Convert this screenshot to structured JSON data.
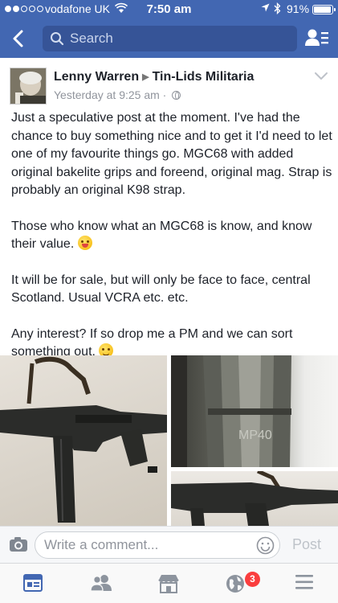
{
  "status_bar": {
    "carrier": "vodafone UK",
    "time": "7:50 am",
    "battery_percent": "91%"
  },
  "nav": {
    "search_placeholder": "Search"
  },
  "post": {
    "author": "Lenny Warren",
    "group": "Tin-Lids Militaria",
    "timestamp": "Yesterday at 9:25 am ·",
    "paragraphs": [
      "Just a speculative post at the moment. I've had the chance to buy something nice and to get it I'd need to let one of my favourite things go. MGC68 with added original bakelite grips and foreend, original mag. Strap is probably an original K98 strap.",
      "Those who know what an MGC68 is know, and know their value.",
      "It will be for sale, but will only be face to face, central Scotland. Usual VCRA etc. etc.",
      "Any interest? If so drop me a PM and we can sort something out."
    ],
    "photo_text": "MP40",
    "photo_count": 3
  },
  "comment": {
    "placeholder": "Write a comment...",
    "post_label": "Post"
  },
  "tabbar": {
    "notifications_badge": "3"
  },
  "colors": {
    "header_blue": "#4267b2",
    "badge_red": "#fa3e3e",
    "meta_gray": "#90949c"
  }
}
